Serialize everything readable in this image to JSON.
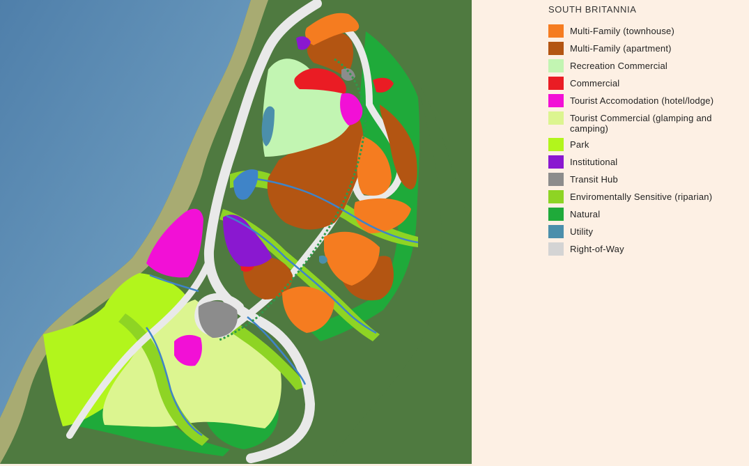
{
  "legend": {
    "title": "SOUTH BRITANNIA",
    "items": [
      {
        "label": "Multi-Family (townhouse)",
        "color": "#f57c20"
      },
      {
        "label": "Multi-Family (apartment)",
        "color": "#b35512"
      },
      {
        "label": "Recreation Commercial",
        "color": "#c2f5b2"
      },
      {
        "label": "Commercial",
        "color": "#ea1c24"
      },
      {
        "label": "Tourist Accomodation (hotel/lodge)",
        "color": "#f210d6"
      },
      {
        "label": "Tourist Commercial (glamping and camping)",
        "color": "#dcf590"
      },
      {
        "label": "Park",
        "color": "#b2f51c"
      },
      {
        "label": "Institutional",
        "color": "#8a18d0"
      },
      {
        "label": "Transit Hub",
        "color": "#8c8c8c"
      },
      {
        "label": "Enviromentally Sensitive (riparian)",
        "color": "#8ed424"
      },
      {
        "label": "Natural",
        "color": "#1faa3a"
      },
      {
        "label": "Utility",
        "color": "#4b8fab"
      },
      {
        "label": "Right-of-Way",
        "color": "#d4d4d4"
      }
    ]
  },
  "map": {
    "colors": {
      "water": "#5e8fb4",
      "forest": "#4f7a40",
      "shore": "#a8ab72",
      "road": "#e9e9e9",
      "channel": "#3f84c8",
      "greenway": "#2f9a4a"
    }
  }
}
